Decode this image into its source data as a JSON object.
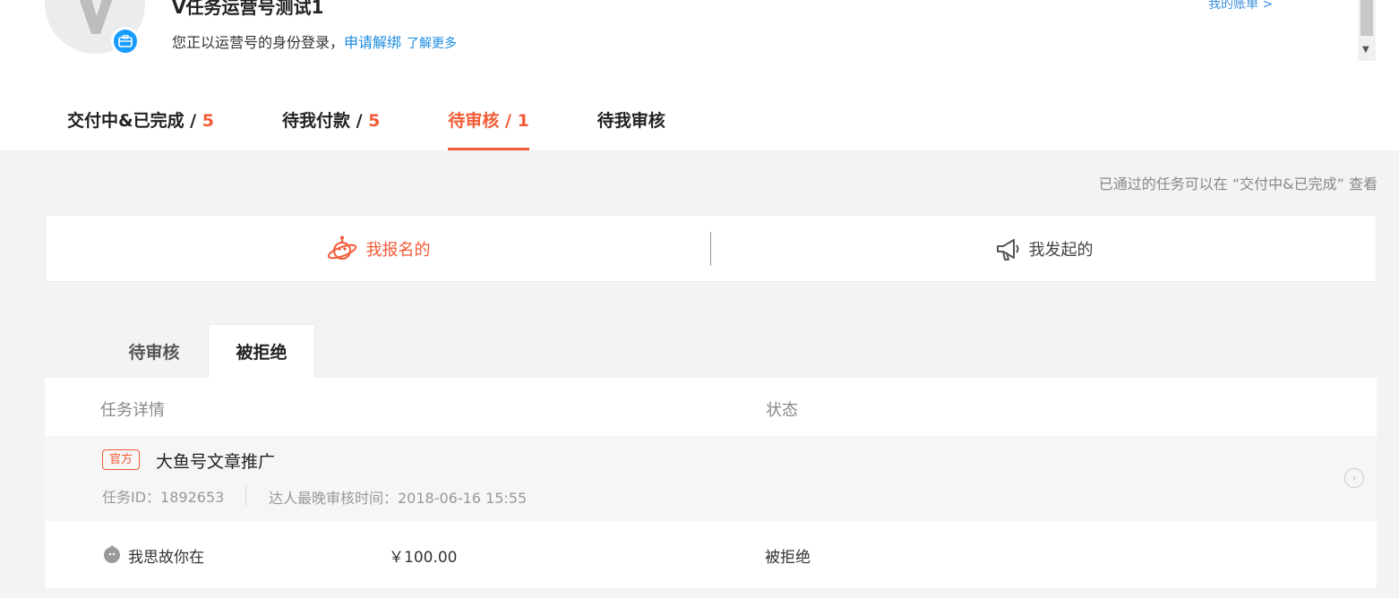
{
  "account": {
    "name": "V任务运营号测试1",
    "login_text": "您正以运营号的身份登录，",
    "unbind_link": "申请解绑",
    "learn_more_link": "了解更多",
    "my_bill": "我的账单 >"
  },
  "main_tabs": [
    {
      "label": "交付中&已完成 / ",
      "count": "5"
    },
    {
      "label": "待我付款 / ",
      "count": "5"
    },
    {
      "label": "待审核 / ",
      "count": "1"
    },
    {
      "label": "待我审核",
      "count": ""
    }
  ],
  "hint": "已通过的任务可以在 “交付中&已完成” 查看",
  "switch": {
    "left_label": "我报名的",
    "right_label": "我发起的"
  },
  "sub_tabs": [
    "待审核",
    "被拒绝"
  ],
  "columns": {
    "detail": "任务详情",
    "status": "状态"
  },
  "task": {
    "tag": "官方",
    "title": "大鱼号文章推广",
    "id": "任务ID：1892653",
    "deadline": "达人最晚审核时间：2018-06-16 15:55"
  },
  "entry": {
    "name": "我思故你在",
    "price": "￥100.00",
    "status": "被拒绝"
  },
  "colors": {
    "accent": "#f25b36",
    "link": "#1a8be0",
    "badge": "#1a9cff"
  }
}
